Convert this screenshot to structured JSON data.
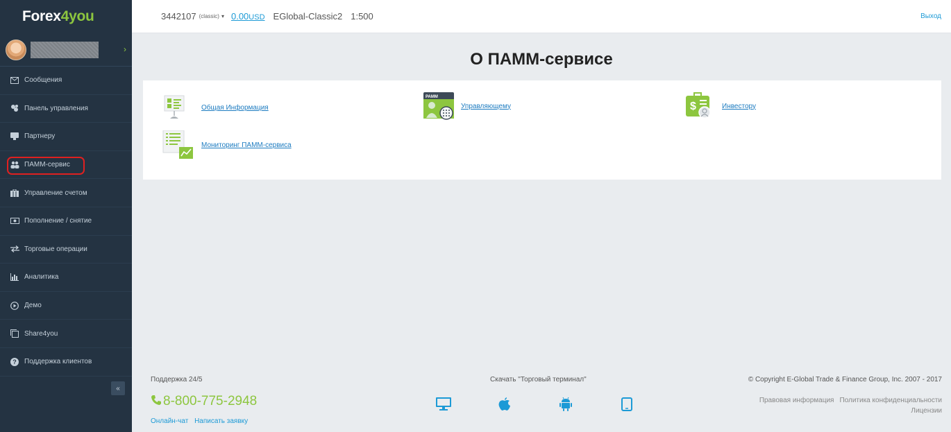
{
  "sidebar": {
    "logo": {
      "part1": "Forex",
      "part2": "4",
      "part3": "you"
    },
    "items": [
      {
        "label": "Сообщения",
        "icon": "envelope-icon"
      },
      {
        "label": "Панель управления",
        "icon": "dashboard-icon"
      },
      {
        "label": "Партнеру",
        "icon": "partner-icon"
      },
      {
        "label": "ПАММ-сервис",
        "icon": "users-icon"
      },
      {
        "label": "Управление счетом",
        "icon": "briefcase-icon"
      },
      {
        "label": "Пополнение / снятие",
        "icon": "money-icon"
      },
      {
        "label": "Торговые операции",
        "icon": "exchange-icon"
      },
      {
        "label": "Аналитика",
        "icon": "bar-chart-icon"
      },
      {
        "label": "Демо",
        "icon": "play-circle-icon"
      },
      {
        "label": "Share4you",
        "icon": "copy-icon"
      },
      {
        "label": "Поддержка клиентов",
        "icon": "question-circle-icon"
      }
    ],
    "collapse_label": "«",
    "user_chevron": "›"
  },
  "topbar": {
    "account_number": "3442107",
    "account_type": "(classic)",
    "caret": "▾",
    "balance": "0.00",
    "currency": "USD",
    "server": "EGlobal-Classic2",
    "leverage": "1:500",
    "logout": "Выход"
  },
  "main": {
    "title": "О ПАММ-сервисе",
    "links": [
      {
        "label": "Общая Информация",
        "icon": "info-board-icon"
      },
      {
        "label": "Управляющему",
        "icon": "pamm-manager-icon",
        "badge": "PAMM"
      },
      {
        "label": "Инвестору",
        "icon": "investor-icon",
        "symbol": "$"
      },
      {
        "label": "Мониторинг ПАММ-сервиса",
        "icon": "monitoring-icon"
      }
    ]
  },
  "footer": {
    "support_title": "Поддержка 24/5",
    "phone": "8-800-775-2948",
    "online_chat": "Онлайн-чат",
    "write_request": "Написать заявку",
    "download_title": "Скачать \"Торговый терминал\"",
    "apps": [
      "desktop-icon",
      "apple-icon",
      "android-icon",
      "tablet-icon"
    ],
    "copyright": "© Copyright E-Global Trade & Finance Group, Inc. 2007 - 2017",
    "legal_info": "Правовая информация",
    "privacy_policy": "Политика конфиденциальности",
    "licenses": "Лицензии"
  },
  "colors": {
    "sidebar_bg": "#243342",
    "accent_green": "#8dc63f",
    "link_blue": "#1c9ad6",
    "highlight_red": "#e02020"
  }
}
